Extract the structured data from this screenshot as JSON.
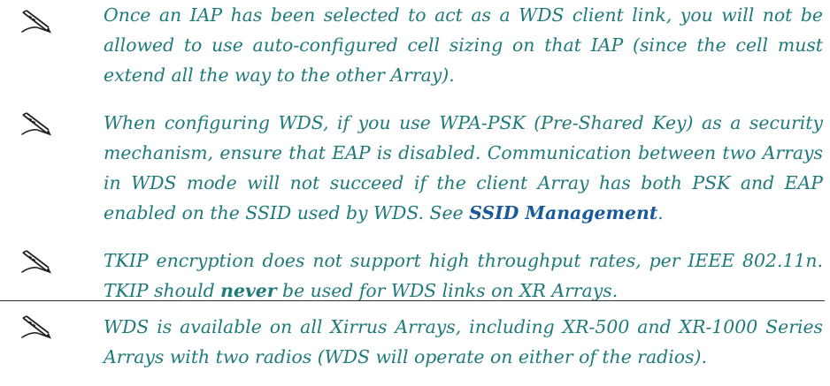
{
  "notes": [
    {
      "icon": "pencil-note-icon",
      "text": "Once an IAP has been selected to act as a WDS client link, you will not be allowed to use auto-configured cell sizing on that IAP (since the cell must extend all the way to the other Array)."
    },
    {
      "icon": "pencil-note-icon",
      "text_before_link": "When configuring WDS, if you use WPA-PSK (Pre-Shared Key) as a security mechanism, ensure that EAP is disabled. Communication between two Arrays in WDS mode will not succeed if the client Array has both PSK and EAP enabled on the SSID used by WDS. See ",
      "link_text": "SSID Management",
      "text_after_link": "."
    },
    {
      "icon": "pencil-note-icon",
      "text_part1": "TKIP encryption does not support high throughput rates, per IEEE 802.11n. TKIP should ",
      "emphasis": "never",
      "text_part2": " be used for WDS links on XR Arrays."
    },
    {
      "icon": "pencil-note-icon",
      "text": "WDS is available on all Xirrus Arrays, including XR-500 and XR-1000 Series Arrays with two radios (WDS will operate on either of the radios)."
    }
  ],
  "colors": {
    "note_text": "#1f7a7a",
    "link": "#1a5a9a",
    "divider": "#333333"
  }
}
